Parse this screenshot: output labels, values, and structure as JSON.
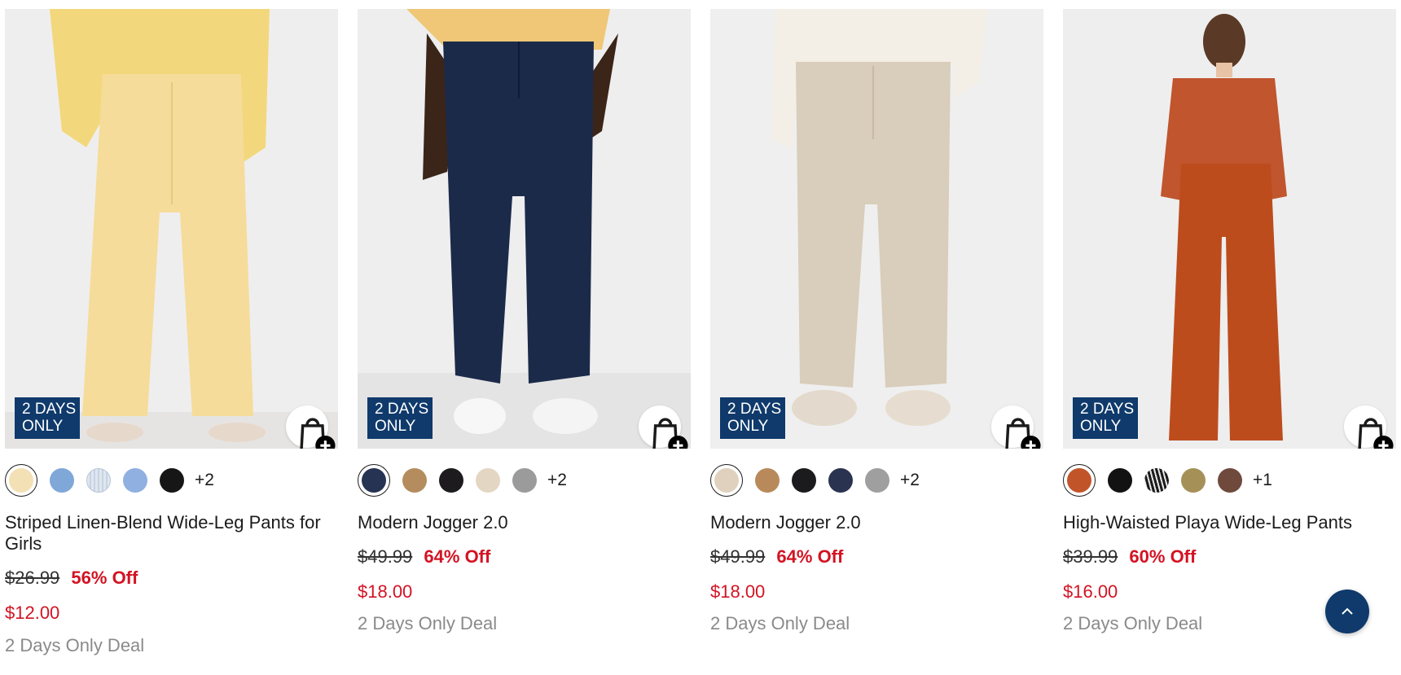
{
  "products": [
    {
      "badge_line1": "2 DAYS",
      "badge_line2": "ONLY",
      "title": "Striped Linen-Blend Wide-Leg Pants for Girls",
      "original_price": "$26.99",
      "discount": "56% Off",
      "sale_price": "$12.00",
      "deal_text": "2 Days Only Deal",
      "more_colors": "+2",
      "swatches": [
        "#f3e0b5",
        "#7fa8d8",
        "#dfe7ef",
        "#8fb0e0",
        "#161616"
      ],
      "image_colors": {
        "garment": "#f6dc9a",
        "top": "#f3d77c",
        "bg": "#efeeee"
      }
    },
    {
      "badge_line1": "2 DAYS",
      "badge_line2": "ONLY",
      "title": "Modern Jogger 2.0",
      "original_price": "$49.99",
      "discount": "64% Off",
      "sale_price": "$18.00",
      "deal_text": "2 Days Only Deal",
      "more_colors": "+2",
      "swatches": [
        "#263353",
        "#b48c5d",
        "#1d1b1e",
        "#e3d6c2",
        "#9b9b9b"
      ],
      "image_colors": {
        "garment": "#1c2a4a",
        "top": "#efc777",
        "bg": "#eeeeee"
      }
    },
    {
      "badge_line1": "2 DAYS",
      "badge_line2": "ONLY",
      "title": "Modern Jogger 2.0",
      "original_price": "$49.99",
      "discount": "64% Off",
      "sale_price": "$18.00",
      "deal_text": "2 Days Only Deal",
      "more_colors": "+2",
      "swatches": [
        "#dfd1bd",
        "#b8895a",
        "#1b1a1c",
        "#2a3350",
        "#9f9f9f"
      ],
      "image_colors": {
        "garment": "#d9cdbb",
        "top": "#f3efe6",
        "bg": "#efefef"
      }
    },
    {
      "badge_line1": "2 DAYS",
      "badge_line2": "ONLY",
      "title": "High-Waisted Playa Wide-Leg Pants",
      "original_price": "$39.99",
      "discount": "60% Off",
      "sale_price": "$16.00",
      "deal_text": "2 Days Only Deal",
      "more_colors": "+1",
      "swatches": [
        "#c2542a",
        "#121212",
        "#2a2a2a",
        "#a59058",
        "#6f4a3c"
      ],
      "image_colors": {
        "garment": "#bd4c1d",
        "top": "#c0552e",
        "bg": "#eeeeee"
      }
    }
  ],
  "colors": {
    "badge_bg": "#0f3a6b",
    "sale_red": "#d31323",
    "deal_gray": "#8a8a8a",
    "scroll_top_bg": "#0f3a6b"
  },
  "icons": {
    "quick_add": "shopping-bag-plus-icon",
    "scroll_top": "chevron-up-icon"
  }
}
